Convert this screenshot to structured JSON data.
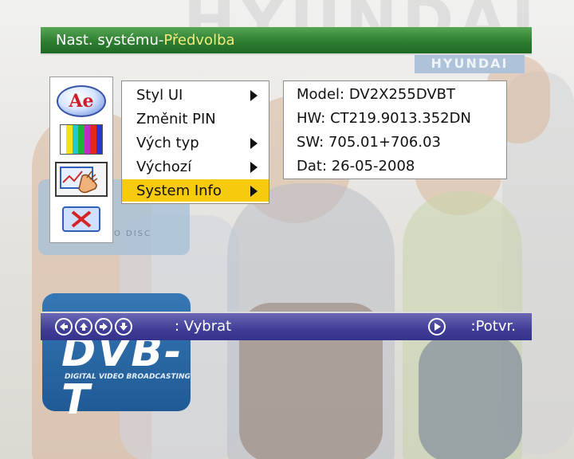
{
  "title": {
    "main": "Nast. systému-",
    "sub": "Předvolba"
  },
  "background": {
    "brand_word": "HYUNDAI",
    "big_word": "HYUNDAI",
    "dvd_text": "IDEO DISC",
    "dvbt_logo": "DVB-T",
    "dvbt_caption": "DIGITAL VIDEO BROADCASTING"
  },
  "icons": [
    {
      "name": "language-icon",
      "glyph": "Ae"
    },
    {
      "name": "color-bars-icon"
    },
    {
      "name": "setup-hand-icon"
    },
    {
      "name": "cancel-icon"
    }
  ],
  "menu": {
    "items": [
      {
        "label": "Styl UI",
        "arrow": true
      },
      {
        "label": "Změnit PIN",
        "arrow": false
      },
      {
        "label": "Vých typ",
        "arrow": true
      },
      {
        "label": "Výchozí",
        "arrow": true
      },
      {
        "label": "System Info",
        "arrow": true,
        "selected": true
      }
    ]
  },
  "info": {
    "model": "Model: DV2X255DVBT",
    "hw": "HW: CT219.9013.352DN",
    "sw": "SW: 705.01+706.03",
    "date": "Dat: 26-05-2008"
  },
  "footer": {
    "select_hint": ": Vybrat",
    "confirm_hint": ":Potvr."
  },
  "colors": {
    "title_green": "#2e7e31",
    "subtitle_yellow": "#f2ec7e",
    "selection_yellow": "#f7cb0d",
    "footer_purple": "#3f3d97"
  }
}
